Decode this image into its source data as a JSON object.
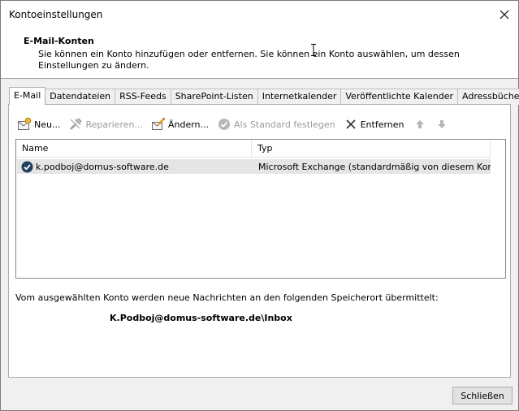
{
  "window": {
    "title": "Kontoeinstellungen"
  },
  "header": {
    "title": "E-Mail-Konten",
    "description": "Sie können ein Konto hinzufügen oder entfernen. Sie können ein Konto auswählen, um dessen Einstellungen zu ändern."
  },
  "tabs": [
    {
      "label": "E-Mail",
      "active": true
    },
    {
      "label": "Datendateien",
      "active": false
    },
    {
      "label": "RSS-Feeds",
      "active": false
    },
    {
      "label": "SharePoint-Listen",
      "active": false
    },
    {
      "label": "Internetkalender",
      "active": false
    },
    {
      "label": "Veröffentlichte Kalender",
      "active": false
    },
    {
      "label": "Adressbücher",
      "active": false
    }
  ],
  "toolbar": {
    "new_label": "Neu...",
    "repair_label": "Reparieren...",
    "change_label": "Ändern...",
    "set_default_label": "Als Standard festlegen",
    "remove_label": "Entfernen"
  },
  "list": {
    "columns": {
      "name": "Name",
      "type": "Typ"
    },
    "rows": [
      {
        "name": "k.podboj@domus-software.de",
        "type": "Microsoft Exchange (standardmäßig von diesem Kon..."
      }
    ]
  },
  "delivery": {
    "info": "Vom ausgewählten Konto werden neue Nachrichten an den folgenden Speicherort übermittelt:",
    "path": "K.Podboj@domus-software.de\\Inbox"
  },
  "footer": {
    "close_label": "Schließen"
  },
  "colors": {
    "accent": "#0078d7",
    "selection": "#e5e5e5",
    "disabled_text": "#9a9a9a"
  }
}
